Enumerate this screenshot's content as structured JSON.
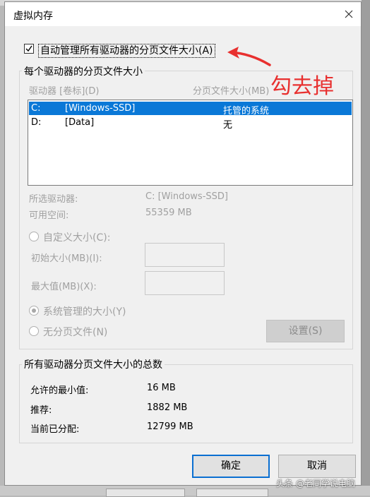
{
  "title": "虚拟内存",
  "auto_manage": {
    "label": "自动管理所有驱动器的分页文件大小(A)",
    "checked": true
  },
  "per_drive": {
    "legend": "每个驱动器的分页文件大小",
    "col_drive": "驱动器 [卷标](D)",
    "col_size": "分页文件大小(MB)",
    "rows": [
      {
        "drive": "C:",
        "label": "[Windows-SSD]",
        "size": "托管的系统",
        "selected": true
      },
      {
        "drive": "D:",
        "label": "[Data]",
        "size": "无",
        "selected": false
      }
    ],
    "selected_drive_label": "所选驱动器:",
    "selected_drive_value": "C:  [Windows-SSD]",
    "free_space_label": "可用空间:",
    "free_space_value": "55359 MB",
    "custom_size_label": "自定义大小(C):",
    "initial_size_label": "初始大小(MB)(I):",
    "max_size_label": "最大值(MB)(X):",
    "system_managed_label": "系统管理的大小(Y)",
    "no_paging_label": "无分页文件(N)",
    "set_button": "设置(S)"
  },
  "totals": {
    "legend": "所有驱动器分页文件大小的总数",
    "min_label": "允许的最小值:",
    "min_value": "16 MB",
    "recommended_label": "推荐:",
    "recommended_value": "1882 MB",
    "current_label": "当前已分配:",
    "current_value": "12799 MB"
  },
  "buttons": {
    "ok": "确定",
    "cancel": "取消"
  },
  "annotation": "勾去掉",
  "watermark": "头条 @老同学说电脑",
  "colors": {
    "selection": "#0a78d7",
    "annotation": "#e8302f",
    "ok_border": "#0a6fd1"
  }
}
